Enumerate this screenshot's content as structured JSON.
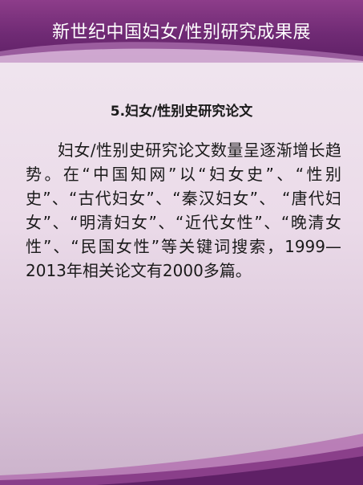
{
  "header": {
    "title": "新世纪中国妇女/性别研究成果展"
  },
  "section": {
    "heading": "5.妇女/性别史研究论文",
    "paragraph": "妇女/性别史研究论文数量呈逐渐增长趋势。在“中国知网”以“妇女史”、“性别史”、“古代妇女”、“秦汉妇女”、 “唐代妇女”、“明清妇女”、“近代女性”、“晚清女性”、“民国女性”等关键词搜索，1999—2013年相关论文有2000多篇。"
  },
  "colors": {
    "header": "#6f2a74",
    "accent": "#a64ea3"
  }
}
